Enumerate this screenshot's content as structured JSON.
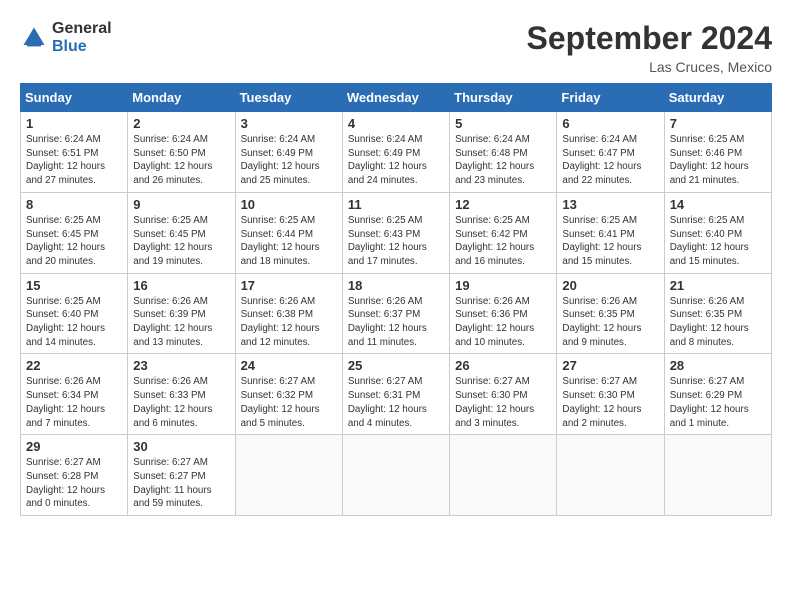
{
  "header": {
    "logo_line1": "General",
    "logo_line2": "Blue",
    "month": "September 2024",
    "location": "Las Cruces, Mexico"
  },
  "columns": [
    "Sunday",
    "Monday",
    "Tuesday",
    "Wednesday",
    "Thursday",
    "Friday",
    "Saturday"
  ],
  "weeks": [
    [
      {
        "day": "1",
        "detail": "Sunrise: 6:24 AM\nSunset: 6:51 PM\nDaylight: 12 hours\nand 27 minutes."
      },
      {
        "day": "2",
        "detail": "Sunrise: 6:24 AM\nSunset: 6:50 PM\nDaylight: 12 hours\nand 26 minutes."
      },
      {
        "day": "3",
        "detail": "Sunrise: 6:24 AM\nSunset: 6:49 PM\nDaylight: 12 hours\nand 25 minutes."
      },
      {
        "day": "4",
        "detail": "Sunrise: 6:24 AM\nSunset: 6:49 PM\nDaylight: 12 hours\nand 24 minutes."
      },
      {
        "day": "5",
        "detail": "Sunrise: 6:24 AM\nSunset: 6:48 PM\nDaylight: 12 hours\nand 23 minutes."
      },
      {
        "day": "6",
        "detail": "Sunrise: 6:24 AM\nSunset: 6:47 PM\nDaylight: 12 hours\nand 22 minutes."
      },
      {
        "day": "7",
        "detail": "Sunrise: 6:25 AM\nSunset: 6:46 PM\nDaylight: 12 hours\nand 21 minutes."
      }
    ],
    [
      {
        "day": "8",
        "detail": "Sunrise: 6:25 AM\nSunset: 6:45 PM\nDaylight: 12 hours\nand 20 minutes."
      },
      {
        "day": "9",
        "detail": "Sunrise: 6:25 AM\nSunset: 6:45 PM\nDaylight: 12 hours\nand 19 minutes."
      },
      {
        "day": "10",
        "detail": "Sunrise: 6:25 AM\nSunset: 6:44 PM\nDaylight: 12 hours\nand 18 minutes."
      },
      {
        "day": "11",
        "detail": "Sunrise: 6:25 AM\nSunset: 6:43 PM\nDaylight: 12 hours\nand 17 minutes."
      },
      {
        "day": "12",
        "detail": "Sunrise: 6:25 AM\nSunset: 6:42 PM\nDaylight: 12 hours\nand 16 minutes."
      },
      {
        "day": "13",
        "detail": "Sunrise: 6:25 AM\nSunset: 6:41 PM\nDaylight: 12 hours\nand 15 minutes."
      },
      {
        "day": "14",
        "detail": "Sunrise: 6:25 AM\nSunset: 6:40 PM\nDaylight: 12 hours\nand 15 minutes."
      }
    ],
    [
      {
        "day": "15",
        "detail": "Sunrise: 6:25 AM\nSunset: 6:40 PM\nDaylight: 12 hours\nand 14 minutes."
      },
      {
        "day": "16",
        "detail": "Sunrise: 6:26 AM\nSunset: 6:39 PM\nDaylight: 12 hours\nand 13 minutes."
      },
      {
        "day": "17",
        "detail": "Sunrise: 6:26 AM\nSunset: 6:38 PM\nDaylight: 12 hours\nand 12 minutes."
      },
      {
        "day": "18",
        "detail": "Sunrise: 6:26 AM\nSunset: 6:37 PM\nDaylight: 12 hours\nand 11 minutes."
      },
      {
        "day": "19",
        "detail": "Sunrise: 6:26 AM\nSunset: 6:36 PM\nDaylight: 12 hours\nand 10 minutes."
      },
      {
        "day": "20",
        "detail": "Sunrise: 6:26 AM\nSunset: 6:35 PM\nDaylight: 12 hours\nand 9 minutes."
      },
      {
        "day": "21",
        "detail": "Sunrise: 6:26 AM\nSunset: 6:35 PM\nDaylight: 12 hours\nand 8 minutes."
      }
    ],
    [
      {
        "day": "22",
        "detail": "Sunrise: 6:26 AM\nSunset: 6:34 PM\nDaylight: 12 hours\nand 7 minutes."
      },
      {
        "day": "23",
        "detail": "Sunrise: 6:26 AM\nSunset: 6:33 PM\nDaylight: 12 hours\nand 6 minutes."
      },
      {
        "day": "24",
        "detail": "Sunrise: 6:27 AM\nSunset: 6:32 PM\nDaylight: 12 hours\nand 5 minutes."
      },
      {
        "day": "25",
        "detail": "Sunrise: 6:27 AM\nSunset: 6:31 PM\nDaylight: 12 hours\nand 4 minutes."
      },
      {
        "day": "26",
        "detail": "Sunrise: 6:27 AM\nSunset: 6:30 PM\nDaylight: 12 hours\nand 3 minutes."
      },
      {
        "day": "27",
        "detail": "Sunrise: 6:27 AM\nSunset: 6:30 PM\nDaylight: 12 hours\nand 2 minutes."
      },
      {
        "day": "28",
        "detail": "Sunrise: 6:27 AM\nSunset: 6:29 PM\nDaylight: 12 hours\nand 1 minute."
      }
    ],
    [
      {
        "day": "29",
        "detail": "Sunrise: 6:27 AM\nSunset: 6:28 PM\nDaylight: 12 hours\nand 0 minutes."
      },
      {
        "day": "30",
        "detail": "Sunrise: 6:27 AM\nSunset: 6:27 PM\nDaylight: 11 hours\nand 59 minutes."
      },
      {
        "day": "",
        "detail": ""
      },
      {
        "day": "",
        "detail": ""
      },
      {
        "day": "",
        "detail": ""
      },
      {
        "day": "",
        "detail": ""
      },
      {
        "day": "",
        "detail": ""
      }
    ]
  ]
}
